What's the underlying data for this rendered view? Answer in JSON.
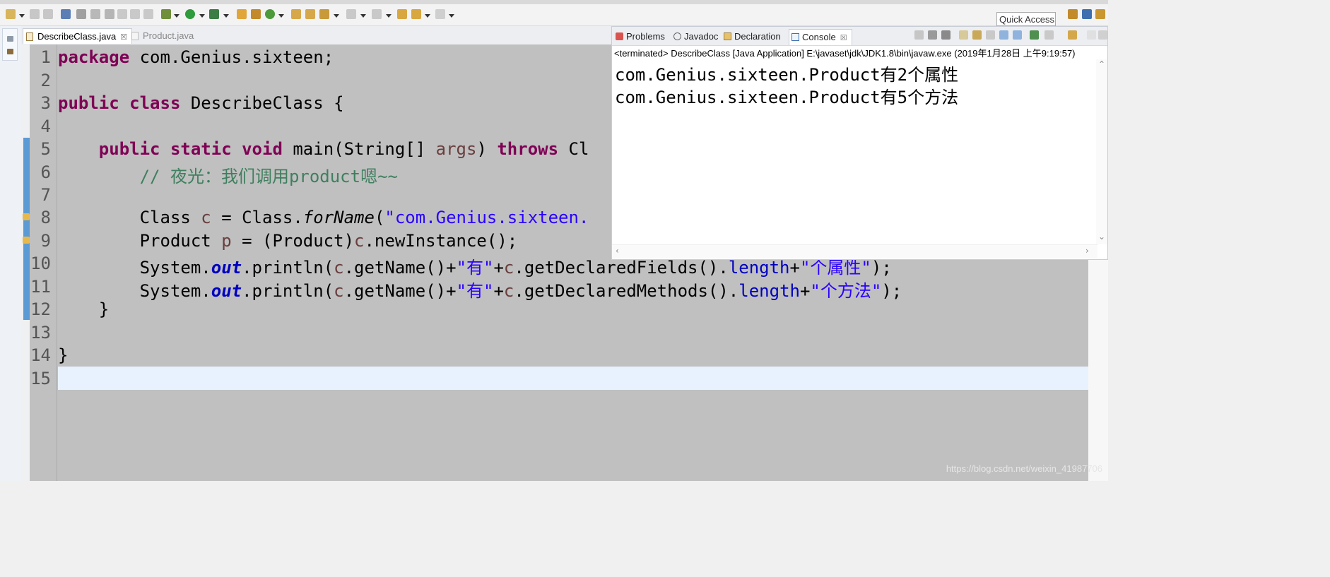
{
  "toolbar": {
    "quick_access": "Quick Access"
  },
  "editor": {
    "tabs": [
      {
        "label": "DescribeClass.java",
        "close": "☒"
      },
      {
        "label": "Product.java"
      }
    ],
    "lines": [
      {
        "n": "1"
      },
      {
        "n": "2"
      },
      {
        "n": "3"
      },
      {
        "n": "4"
      },
      {
        "n": "5"
      },
      {
        "n": "6"
      },
      {
        "n": "7"
      },
      {
        "n": "8"
      },
      {
        "n": "9"
      },
      {
        "n": "10"
      },
      {
        "n": "11"
      },
      {
        "n": "12"
      },
      {
        "n": "13"
      },
      {
        "n": "14"
      },
      {
        "n": "15"
      }
    ],
    "code": {
      "l1_kw": "package",
      "l1_rest": " com.Genius.sixteen;",
      "l3_kw1": "public",
      "l3_kw2": "class",
      "l3_rest": " DescribeClass {",
      "l5_kw1": "public",
      "l5_kw2": "static",
      "l5_kw3": "void",
      "l5_a": " main(String[] ",
      "l5_args": "args",
      "l5_b": ") ",
      "l5_kw4": "throws",
      "l5_c": " Cl",
      "l6_cmt": "// 夜光：我们调用product嗯~~",
      "l8_a": "Class ",
      "l8_c": "c",
      "l8_b": " = Class.",
      "l8_fn": "forName",
      "l8_d": "(",
      "l8_str": "\"com.Genius.sixteen.",
      "l9_a": "Product ",
      "l9_p": "p",
      "l9_b": " = (Product)",
      "l9_c": "c",
      "l9_d": ".newInstance();",
      "l10_a": "System.",
      "l10_out": "out",
      "l10_b": ".println(",
      "l10_c": "c",
      "l10_d": ".getName()+",
      "l10_s1": "\"有\"",
      "l10_e": "+",
      "l10_c2": "c",
      "l10_f": ".getDeclaredFields().",
      "l10_len": "length",
      "l10_g": "+",
      "l10_s2": "\"个属性\"",
      "l10_h": ");",
      "l11_a": "System.",
      "l11_out": "out",
      "l11_b": ".println(",
      "l11_c": "c",
      "l11_d": ".getName()+",
      "l11_s1": "\"有\"",
      "l11_e": "+",
      "l11_c2": "c",
      "l11_f": ".getDeclaredMethods().",
      "l11_len": "length",
      "l11_g": "+",
      "l11_s2": "\"个方法\"",
      "l11_h": ");",
      "l12": "    }",
      "l14": "}"
    }
  },
  "console": {
    "tabs": [
      {
        "label": "Problems"
      },
      {
        "label": "Javadoc"
      },
      {
        "label": "Declaration"
      },
      {
        "label": "Console",
        "close": "☒"
      }
    ],
    "status": "<terminated> DescribeClass [Java Application] E:\\javaset\\jdk\\JDK1.8\\bin\\javaw.exe (2019年1月28日 上午9:19:57)",
    "output": [
      "com.Genius.sixteen.Product有2个属性",
      "com.Genius.sixteen.Product有5个方法"
    ]
  },
  "watermark": "https://blog.csdn.net/weixin_41987706",
  "colors": {
    "keyword": "#7f0055",
    "string": "#2a00ff",
    "comment": "#3f7f5f",
    "field": "#0000c0",
    "editor_bg": "#c0c0c0",
    "current_line": "#e8f2fe"
  }
}
